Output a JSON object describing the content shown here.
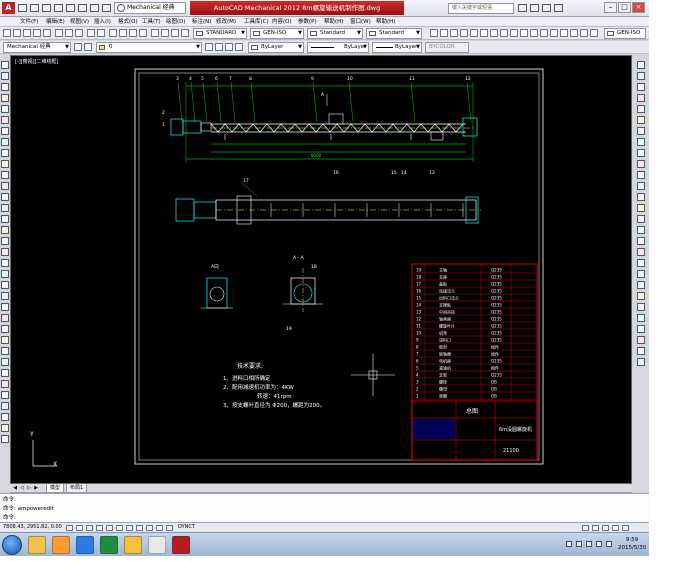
{
  "window": {
    "title": "AutoCAD Mechanical 2012    8m螺旋输送机制作图.dwg",
    "workspace": "Mechanical 经典",
    "search_placeholder": "键入关键字或短语",
    "buttons": {
      "minimize": "–",
      "maximize": "□",
      "close": "×"
    }
  },
  "menu": [
    "文件(F)",
    "编辑(E)",
    "视图(V)",
    "插入(I)",
    "格式(O)",
    "工具(T)",
    "绘图(D)",
    "标注(N)",
    "修改(M)",
    "工具库(C)",
    "内容(O)",
    "参数(P)",
    "帮助(H)",
    "窗口(W)",
    "帮助(H)"
  ],
  "toolbar_styles": {
    "text_style": "STANDARD",
    "dim_style": "GEN-ISO",
    "table_style": "Standard",
    "multileader_style": "Standard",
    "dim_style_right": "GEN-ISO"
  },
  "toolbar_layers": {
    "workspace": "Mechanical 经典",
    "layer": "0",
    "color": "ByLayer",
    "linetype": "ByLayer",
    "lineweight": "ByLayer",
    "plotstyle": "BYCOLOR"
  },
  "canvas": {
    "viewport_label": "[-][俯视][二维线框]",
    "bg_color": "#000000",
    "drawing": {
      "part_numbers_top": [
        "1",
        "2",
        "3",
        "4",
        "5",
        "6",
        "7",
        "8",
        "9",
        "10",
        "11",
        "12"
      ],
      "part_numbers_mid": [
        "13",
        "14",
        "15",
        "16",
        "17",
        "18",
        "19"
      ],
      "section_label": "A - A",
      "section_mark": "A",
      "view_label": "A向",
      "dim_total": "8000",
      "notes": {
        "title": "技术要求:",
        "lines": [
          "1、进料口相所确定",
          "2、配用减速机功率为：4KW",
          "转速：41rpm",
          "3、按支螺叶直径为 Φ200，螺距为200。"
        ]
      },
      "title_block": {
        "name_cells": [
          "总图",
          "6m没圆螺旋机"
        ],
        "drawing_no": "21100",
        "rows": [
          [
            "19",
            "主轴",
            "Q235"
          ],
          [
            "18",
            "支座",
            "Q235"
          ],
          [
            "17",
            "盖板",
            "Q235"
          ],
          [
            "16",
            "连接法兰",
            "Q235"
          ],
          [
            "15",
            "出料口法兰",
            "Q235"
          ],
          [
            "14",
            "支撑板",
            "Q235"
          ],
          [
            "13",
            "中间吊挂",
            "Q235"
          ],
          [
            "12",
            "轴承座",
            "Q235"
          ],
          [
            "11",
            "螺旋叶片",
            "Q235"
          ],
          [
            "10",
            "机壳",
            "Q235"
          ],
          [
            "9",
            "进料口",
            "Q235"
          ],
          [
            "8",
            "密封",
            "组件"
          ],
          [
            "7",
            "联轴器",
            "组件"
          ],
          [
            "6",
            "电机座",
            "Q235"
          ],
          [
            "5",
            "减速机",
            "组件"
          ],
          [
            "4",
            "支架",
            "Q235"
          ],
          [
            "3",
            "螺栓",
            "GB"
          ],
          [
            "2",
            "螺母",
            "GB"
          ],
          [
            "1",
            "垫圈",
            "GB"
          ]
        ]
      }
    },
    "ucs_x": "X",
    "ucs_y": "Y"
  },
  "tabs": {
    "model": "模型",
    "layout": "布局1"
  },
  "command": {
    "lines": [
      "命令:",
      "命令: ampoweredit",
      "命令:"
    ]
  },
  "status": {
    "coords": "7808.43, 2951.82, 0.00",
    "ducs": "DYNCT"
  },
  "taskbar": {
    "time": "9:59",
    "date": "2015/5/30"
  }
}
